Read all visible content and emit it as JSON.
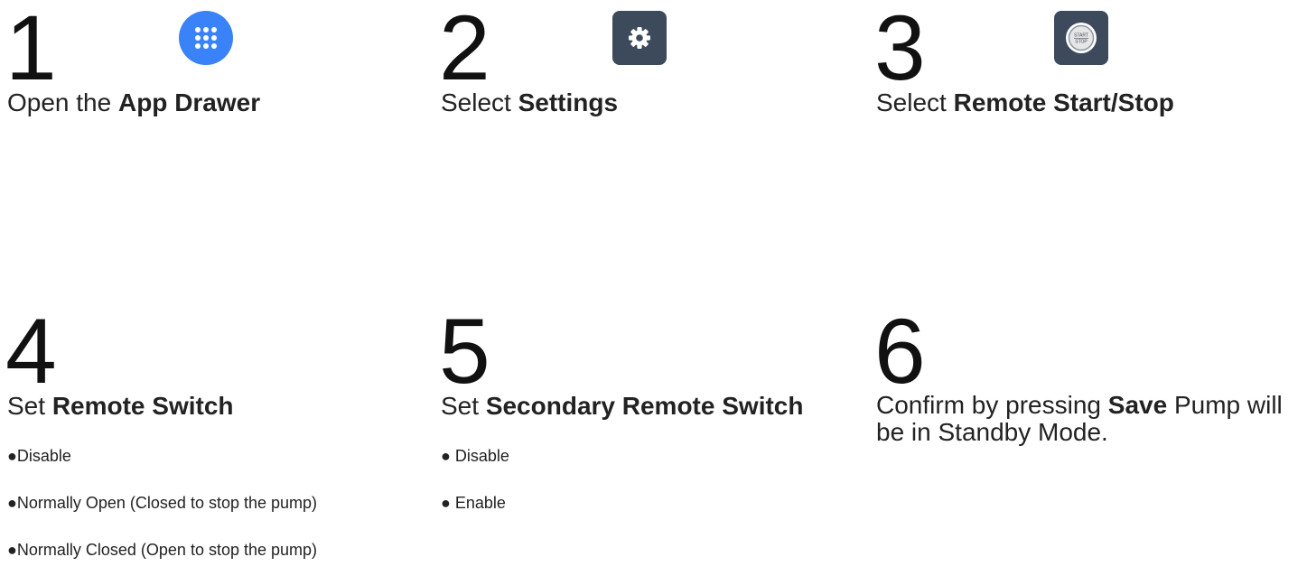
{
  "steps": [
    {
      "number": "1",
      "title_prefix": "Open the ",
      "title_bold": "App Drawer",
      "icon": "app-drawer-grid-icon",
      "icon_color": "#3a82f7"
    },
    {
      "number": "2",
      "title_prefix": "Select ",
      "title_bold": "Settings",
      "icon": "settings-gear-icon",
      "icon_color": "#3d4a5c"
    },
    {
      "number": "3",
      "title_prefix": "Select ",
      "title_bold": "Remote Start/Stop",
      "icon": "start-stop-button-icon",
      "icon_color": "#3d4a5c",
      "icon_text_top": "START",
      "icon_text_bottom": "STOP"
    },
    {
      "number": "4",
      "title_prefix": "Set ",
      "title_bold": "Remote Switch",
      "bullets": [
        "●Disable",
        "●Normally Open (Closed to stop the pump)",
        "●Normally Closed (Open to stop the pump)"
      ]
    },
    {
      "number": "5",
      "title_prefix": "Set ",
      "title_bold": "Secondary Remote Switch",
      "bullets": [
        "● Disable",
        "● Enable"
      ]
    },
    {
      "number": "6",
      "title_prefix": "Confirm by pressing ",
      "title_bold": "Save",
      "title_suffix": " Pump will be in Standby Mode."
    }
  ]
}
